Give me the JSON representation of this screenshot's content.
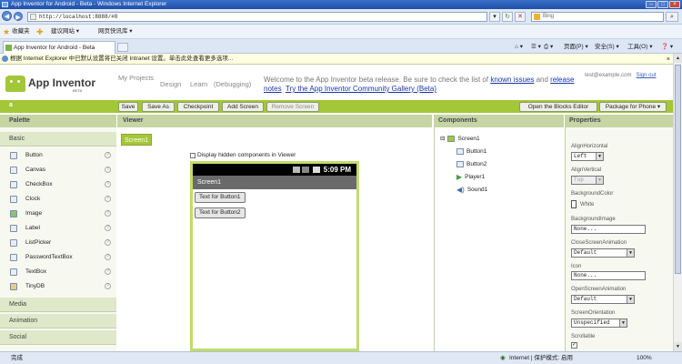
{
  "browser": {
    "title": "App Inventor for Android - Beta - Windows Internet Explorer",
    "address": "http://localhost:8888/#0",
    "search_placeholder": "Bing",
    "favorites_label": "收藏夹",
    "fav_links": [
      "建议网站 ▾",
      "网页快讯库 ▾"
    ],
    "tab_label": "App Inventor for Android - Beta",
    "command_items": [
      "页面(P) ▾",
      "安全(S) ▾",
      "工具(O) ▾",
      "❓ ▾"
    ],
    "infobar_text": "根据 Internet Explorer 中已默认设置将已关闭 Intranet 设置。单击此处查看更多选项...",
    "status_left": "完成",
    "status_zone": "Internet | 保护模式: 启用",
    "status_zoom": "100%"
  },
  "app": {
    "name": "App Inventor",
    "beta": "BETA",
    "nav": [
      "My Projects",
      "Design",
      "Learn",
      "(Debugging)"
    ],
    "welcome_pre": "Welcome to the App Inventor beta release. Be sure to check the list of ",
    "welcome_link1": "known issues",
    "welcome_mid": " and ",
    "welcome_link2": "release notes",
    "welcome_link3": "Try the App Inventor Community Gallery (Beta)",
    "user_email": "test@example.com",
    "sign_out": "Sign out",
    "project_name": "a",
    "toolbar": [
      "Save",
      "Save As",
      "Checkpoint",
      "Add Screen",
      "Remove Screen"
    ],
    "open_blocks": "Open the Blocks Editor",
    "package_phone": "Package for Phone ▾"
  },
  "palette": {
    "heading": "Palette",
    "category_basic": "Basic",
    "items": [
      "Button",
      "Canvas",
      "CheckBox",
      "Clock",
      "Image",
      "Label",
      "ListPicker",
      "PasswordTextBox",
      "TextBox",
      "TinyDB"
    ],
    "categories": [
      "Media",
      "Animation",
      "Social"
    ]
  },
  "viewer": {
    "heading": "Viewer",
    "screen_tab": "Screen1",
    "hidden_label": "Display hidden components in Viewer",
    "time": "5:09 PM",
    "title": "Screen1",
    "buttons": [
      "Text for Button1",
      "Text for Button2"
    ]
  },
  "components": {
    "heading": "Components",
    "toggle": "⊟",
    "root": "Screen1",
    "children": [
      "Button1",
      "Button2",
      "Player1",
      "Sound1"
    ]
  },
  "properties": {
    "heading": "Properties",
    "align_h_label": "AlignHorizontal",
    "align_h_value": "Left",
    "align_v_label": "AlignVertical",
    "align_v_value": "Top",
    "bgcolor_label": "BackgroundColor",
    "bgcolor_value": "White",
    "bgimage_label": "BackgroundImage",
    "bgimage_value": "None...",
    "close_anim_label": "CloseScreenAnimation",
    "close_anim_value": "Default",
    "icon_label": "Icon",
    "icon_value": "None...",
    "open_anim_label": "OpenScreenAnimation",
    "open_anim_value": "Default",
    "orientation_label": "ScreenOrientation",
    "orientation_value": "Unspecified",
    "scrollable_label": "Scrollable"
  }
}
